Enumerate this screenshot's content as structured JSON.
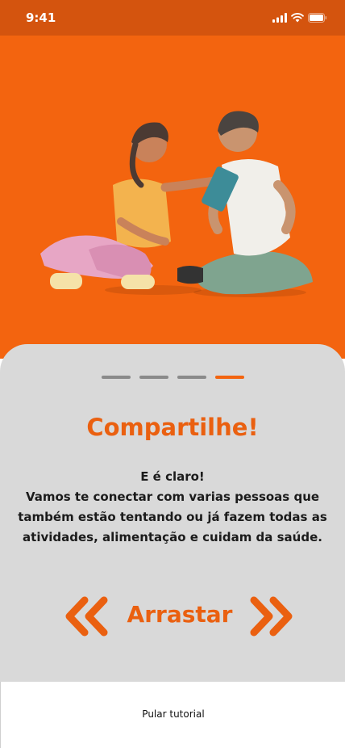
{
  "status_bar": {
    "time": "9:41",
    "icons": [
      "cellular-signal-icon",
      "wifi-icon",
      "battery-icon"
    ]
  },
  "hero": {
    "background_color": "#F3640F",
    "illustration": "two-people-sitting-with-tablet"
  },
  "pager": {
    "total": 4,
    "active_index": 3
  },
  "slide": {
    "title": "Compartilhe!",
    "body_lines": [
      "E é claro!",
      "Vamos te conectar com varias pessoas que",
      "também estão tentando ou já fazem todas as",
      "atividades, alimentação e cuidam da saúde."
    ]
  },
  "swipe": {
    "label": "Arrastar",
    "left_icon": "double-chevron-left-icon",
    "right_icon": "double-chevron-right-icon"
  },
  "footer": {
    "skip_label": "Pular tutorial"
  },
  "colors": {
    "accent": "#F3640F",
    "status_bar": "#D4540E",
    "card": "#D9D9D9",
    "text": "#1b1b1b"
  }
}
